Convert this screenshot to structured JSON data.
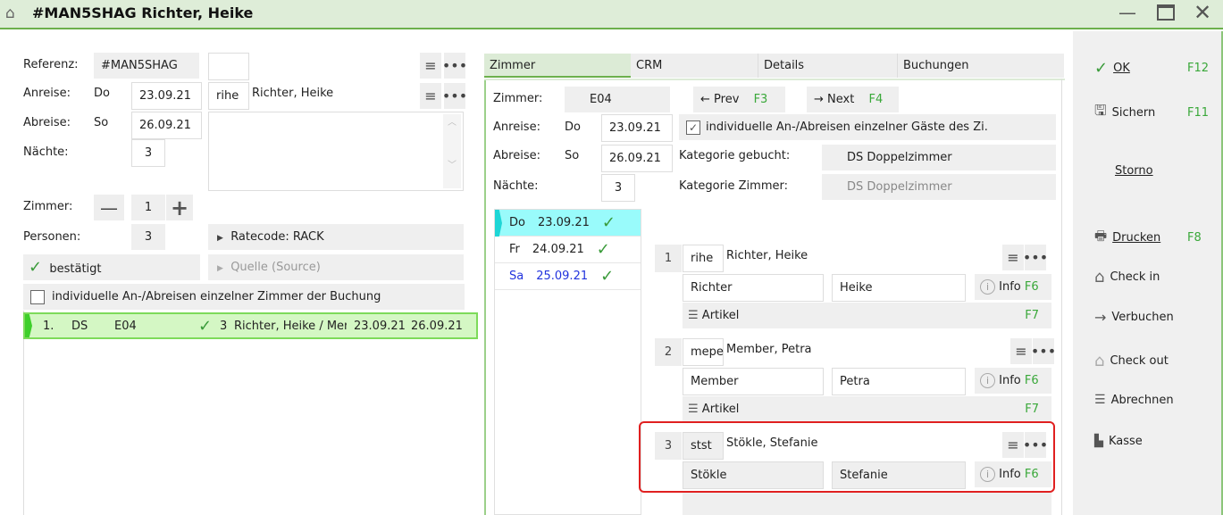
{
  "window": {
    "title": "#MAN5SHAG Richter, Heike"
  },
  "left": {
    "referenz_label": "Referenz:",
    "referenz": "#MAN5SHAG",
    "anreise_label": "Anreise:",
    "anreise_day": "Do",
    "anreise": "23.09.21",
    "abreise_label": "Abreise:",
    "abreise_day": "So",
    "abreise": "26.09.21",
    "naechte_label": "Nächte:",
    "naechte": "3",
    "guest_code": "rihe",
    "guest_name": "Richter, Heike",
    "zimmer_label": "Zimmer:",
    "zimmer": "1",
    "personen_label": "Personen:",
    "personen": "3",
    "ratecode": "Ratecode: RACK",
    "quelle": "Quelle (Source)",
    "status": "bestätigt",
    "individual_label": "individuelle An-/Abreisen einzelner Zimmer der Buchung",
    "rooms": [
      {
        "nr": "1.",
        "cat": "DS",
        "room": "E04",
        "persons": "3",
        "names": "Richter, Heike / Mer",
        "from": "23.09.21",
        "to": "26.09.21"
      }
    ]
  },
  "tabs": [
    "Zimmer",
    "CRM",
    "Details",
    "Buchungen"
  ],
  "room": {
    "zimmer_label": "Zimmer:",
    "zimmer": "E04",
    "prev": "Prev",
    "prev_key": "F3",
    "next": "Next",
    "next_key": "F4",
    "anreise_label": "Anreise:",
    "anreise_day": "Do",
    "anreise": "23.09.21",
    "abreise_label": "Abreise:",
    "abreise_day": "So",
    "abreise": "26.09.21",
    "naechte_label": "Nächte:",
    "naechte": "3",
    "individual_label": "individuelle An-/Abreisen einzelner Gäste des Zi.",
    "kat_gebucht_label": "Kategorie gebucht:",
    "kat_gebucht": "DS Doppelzimmer",
    "kat_zimmer_label": "Kategorie Zimmer:",
    "kat_zimmer": "DS Doppelzimmer",
    "days": [
      {
        "day": "Do",
        "date": "23.09.21"
      },
      {
        "day": "Fr",
        "date": "24.09.21"
      },
      {
        "day": "Sa",
        "date": "25.09.21"
      }
    ]
  },
  "guests": [
    {
      "nr": "1",
      "code": "rihe",
      "name": "Richter, Heike",
      "last": "Richter",
      "first": "Heike",
      "info": "Info",
      "info_key": "F6",
      "artikel": "Artikel",
      "artikel_key": "F7"
    },
    {
      "nr": "2",
      "code": "mepe",
      "name": "Member, Petra",
      "last": "Member",
      "first": "Petra",
      "info": "Info",
      "info_key": "F6",
      "artikel": "Artikel",
      "artikel_key": "F7"
    },
    {
      "nr": "3",
      "code": "stst",
      "name": "Stökle, Stefanie",
      "last": "Stökle",
      "first": "Stefanie",
      "info": "Info",
      "info_key": "F6"
    }
  ],
  "sidebar": {
    "ok": "OK",
    "ok_key": "F12",
    "save": "Sichern",
    "save_key": "F11",
    "storno": "Storno",
    "print": "Drucken",
    "print_key": "F8",
    "checkin": "Check in",
    "book": "Verbuchen",
    "checkout": "Check out",
    "bill": "Abrechnen",
    "cash": "Kasse"
  }
}
